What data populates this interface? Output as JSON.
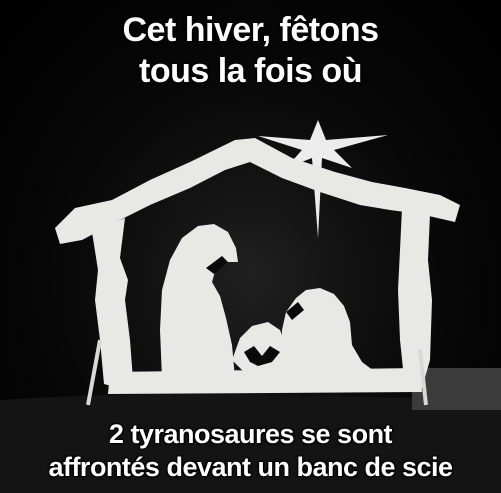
{
  "meme": {
    "top_caption": {
      "line1": "Cet hiver, fêtons",
      "line2": "tous la fois où"
    },
    "bottom_caption": {
      "line1": "2 tyranosaures se sont",
      "line2": "affrontés devant un banc de scie"
    }
  },
  "colors": {
    "background": "#050505",
    "silhouette": "#e8e8e4",
    "text": "#ffffff"
  }
}
